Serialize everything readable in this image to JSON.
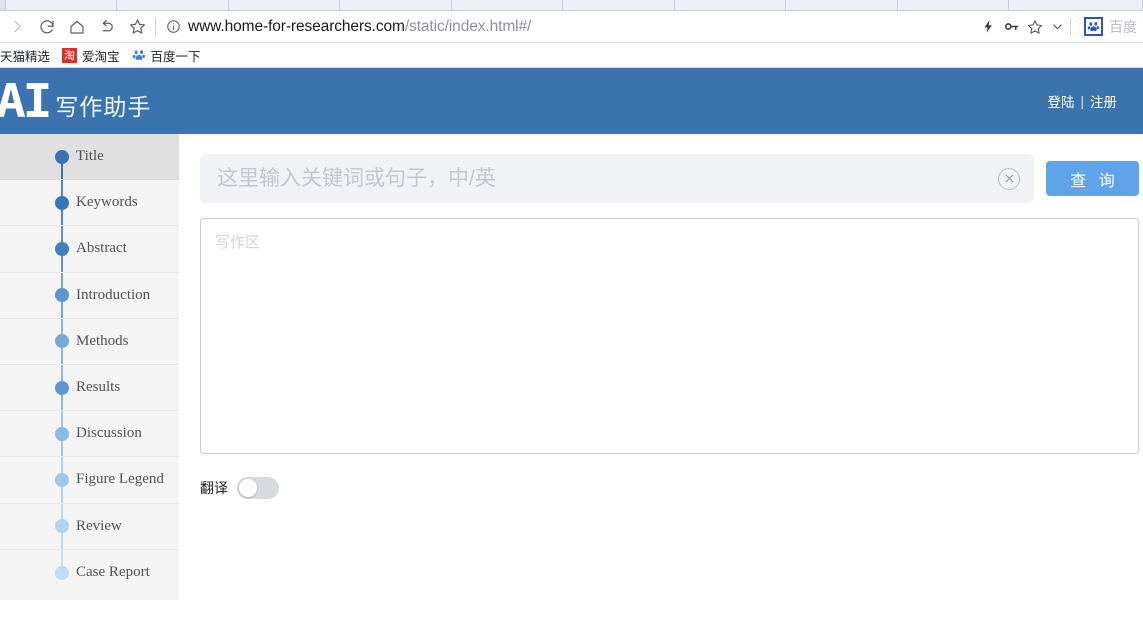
{
  "browser": {
    "toolbar_icons": [
      "forward-arrow",
      "reload",
      "home",
      "back-undo",
      "bookmark-star"
    ],
    "url": {
      "domain": "www.home-for-researchers.com",
      "path": "/static/index.html#/",
      "security_icon": "info-circle-icon"
    },
    "right_icons": [
      "lightning-icon",
      "key-icon",
      "star-icon",
      "chevron-down-icon"
    ],
    "extension": {
      "icon": "baidu-paw-icon",
      "label": "百度"
    },
    "bookmarks": [
      {
        "label": "天猫精选",
        "icon": ""
      },
      {
        "label": "爱淘宝",
        "icon": "taobao-icon"
      },
      {
        "label": "百度一下",
        "icon": "baidu-paw-icon"
      }
    ]
  },
  "header": {
    "logo_text": "AI",
    "logo_subtitle": "写作助手",
    "login_label": "登陆",
    "separator": "|",
    "register_label": "注册",
    "bg_color": "#3b73b0"
  },
  "sidebar": {
    "items": [
      {
        "label": "Title",
        "dot_color": "#3573b9",
        "line_color": "#3573b9",
        "active": true
      },
      {
        "label": "Keywords",
        "dot_color": "#3877bc",
        "line_color": "#4b86c6",
        "active": false
      },
      {
        "label": "Abstract",
        "dot_color": "#4180c2",
        "line_color": "#5b93cf",
        "active": false
      },
      {
        "label": "Introduction",
        "dot_color": "#5b96d0",
        "line_color": "#72a6d8",
        "active": false
      },
      {
        "label": "Methods",
        "dot_color": "#76a9d9",
        "line_color": "#89b8e1",
        "active": false
      },
      {
        "label": "Results",
        "dot_color": "#5e97d1",
        "line_color": "#8ab9e2",
        "active": false
      },
      {
        "label": "Discussion",
        "dot_color": "#8bbae4",
        "line_color": "#9cc6e9",
        "active": false
      },
      {
        "label": "Figure Legend",
        "dot_color": "#9ec7ea",
        "line_color": "#aed2ef",
        "active": false
      },
      {
        "label": "Review",
        "dot_color": "#b3d4f0",
        "line_color": "#bcdaf3",
        "active": false
      },
      {
        "label": "Case Report",
        "dot_color": "#c2dcf4",
        "line_color": "#c8e0f6",
        "active": false
      }
    ]
  },
  "main": {
    "search": {
      "value": "",
      "placeholder": "这里输入关键词或句子，中/英",
      "clear_icon": "close-circle-icon",
      "query_label": "查 询",
      "query_color": "#5fa3e8"
    },
    "editor": {
      "value": "",
      "placeholder": "写作区"
    },
    "translate": {
      "label": "翻译",
      "state": "off"
    }
  }
}
